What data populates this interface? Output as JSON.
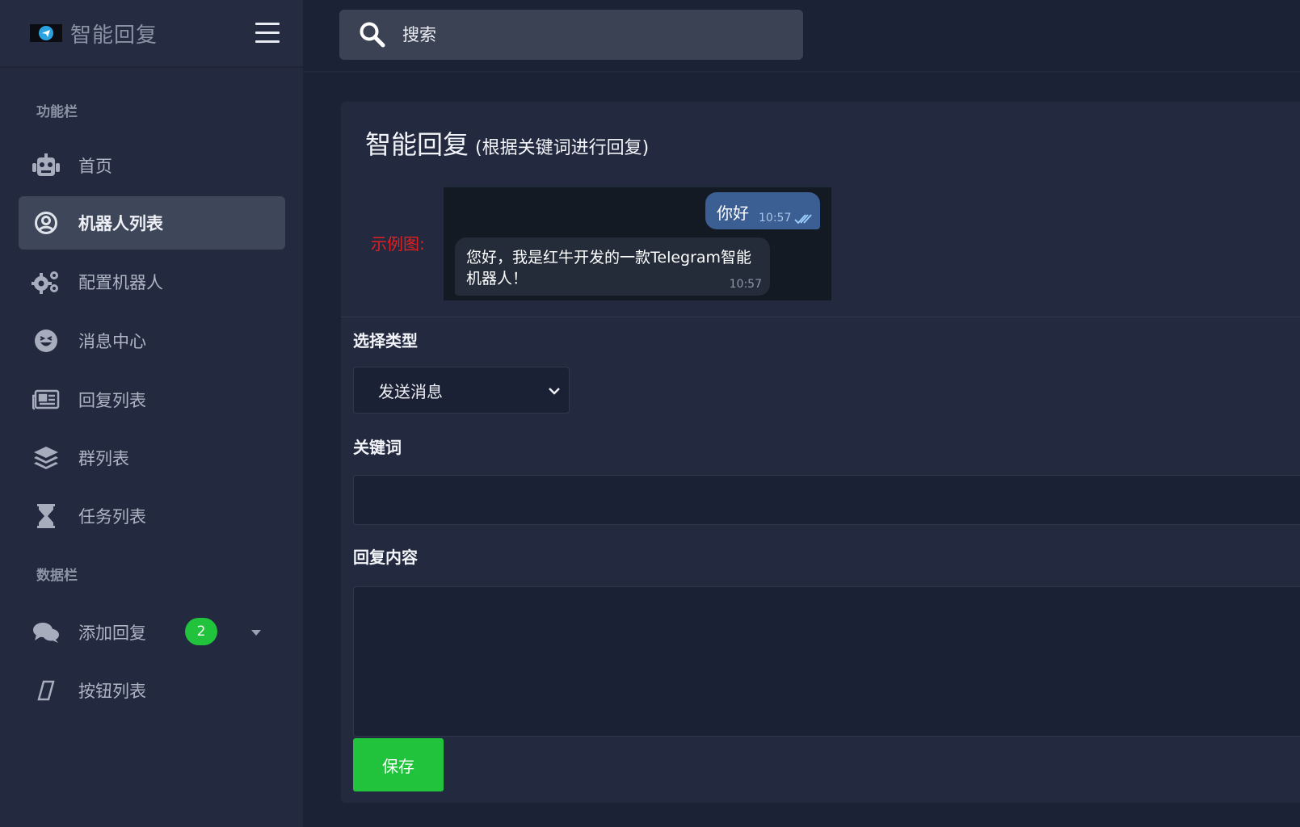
{
  "brand": {
    "title": "智能回复",
    "icon": "telegram-icon"
  },
  "search": {
    "placeholder": "搜索",
    "icon": "search-icon"
  },
  "sidebar": {
    "section_functions": "功能栏",
    "section_data": "数据栏",
    "items": [
      {
        "label": "首页",
        "icon": "robot-icon",
        "active": false
      },
      {
        "label": "机器人列表",
        "icon": "user-circle-icon",
        "active": true
      },
      {
        "label": "配置机器人",
        "icon": "gears-icon",
        "active": false
      },
      {
        "label": "消息中心",
        "icon": "laughing-face-icon",
        "active": false
      },
      {
        "label": "回复列表",
        "icon": "newspaper-icon",
        "active": false
      },
      {
        "label": "群列表",
        "icon": "layers-icon",
        "active": false
      },
      {
        "label": "任务列表",
        "icon": "hourglass-icon",
        "active": false
      }
    ],
    "data_items": [
      {
        "label": "添加回复",
        "icon": "comments-icon",
        "badge": "2"
      },
      {
        "label": "按钮列表",
        "icon": "eraser-icon"
      }
    ]
  },
  "card": {
    "title": "智能回复",
    "subtitle": "(根据关键词进行回复)",
    "example_label": "示例图:",
    "preview": {
      "outgoing": {
        "text": "你好",
        "time": "10:57"
      },
      "incoming": {
        "text": "您好，我是红牛开发的一款Telegram智能机器人！",
        "time": "10:57"
      }
    },
    "type_label": "选择类型",
    "type_value": "发送消息",
    "keyword_label": "关键词",
    "keyword_value": "",
    "reply_label": "回复内容",
    "reply_value": "",
    "save_label": "保存"
  },
  "colors": {
    "accent_green": "#22c33c",
    "sidebar_bg": "#232a3f",
    "page_bg": "#1c2235",
    "active_item_bg": "#3e4659",
    "example_red": "#e02020",
    "bubble_blue": "#3b5f92"
  }
}
